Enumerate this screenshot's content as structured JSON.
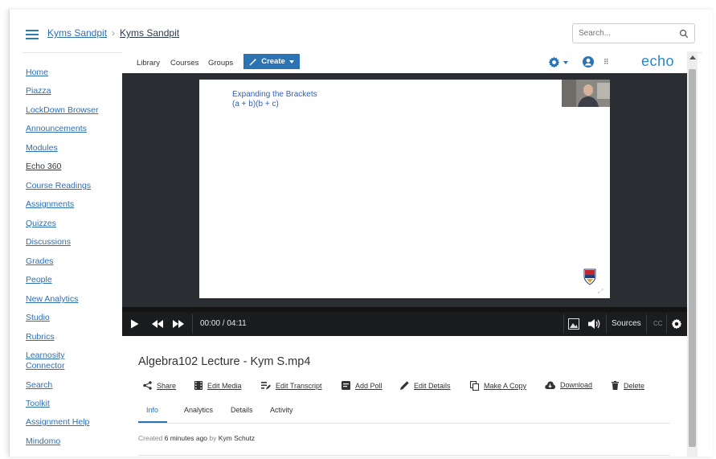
{
  "breadcrumb": {
    "course": "Kyms Sandpit",
    "page": "Kyms Sandpit",
    "separator": "›"
  },
  "search": {
    "placeholder": "Search..."
  },
  "nav": {
    "items": [
      "Home",
      "Piazza",
      "LockDown Browser",
      "Announcements",
      "Modules",
      "Echo 360",
      "Course Readings",
      "Assignments",
      "Quizzes",
      "Discussions",
      "Grades",
      "People",
      "New Analytics",
      "Studio",
      "Rubrics",
      "Learnosity Connector",
      "Search",
      "Toolkit",
      "Assignment Help",
      "Mindomo"
    ],
    "active": "Echo 360"
  },
  "echo": {
    "tabs": [
      "Library",
      "Courses",
      "Groups"
    ],
    "create_label": "Create",
    "logo": "echo"
  },
  "video": {
    "slide_title_line1": "Expanding the Brackets",
    "slide_title_line2": "(a + b)(b + c)",
    "time": "00:00 / 04:11",
    "progress": 0,
    "sources_label": "Sources",
    "cc_label": "CC"
  },
  "media": {
    "title": "Algebra102 Lecture - Kym S.mp4",
    "actions": [
      "Share",
      "Edit Media",
      "Edit Transcript",
      "Add Poll",
      "Edit Details",
      "Make A Copy",
      "Download",
      "Delete"
    ],
    "tabs": [
      "Info",
      "Analytics",
      "Details",
      "Activity"
    ],
    "active_tab": "Info",
    "created_prefix": "Created",
    "created_ago": "6 minutes ago",
    "created_by_word": "by",
    "created_by": "Kym Schutz"
  },
  "colors": {
    "link": "#2d6fb3",
    "accent": "#2b73b3",
    "player_bg": "#2a2d31"
  }
}
